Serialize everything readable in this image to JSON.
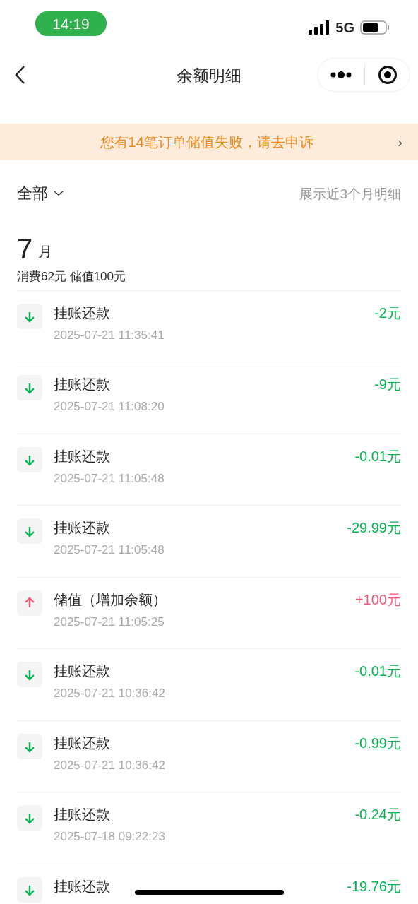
{
  "status_bar": {
    "time": "14:19",
    "network": "5G"
  },
  "nav": {
    "title": "余额明细"
  },
  "notice": {
    "text": "您有14笔订单储值失败，请去申诉",
    "arrow": "›"
  },
  "filter": {
    "label": "全部",
    "hint": "展示近3个月明细"
  },
  "month": {
    "number": "7",
    "unit": "月",
    "summary": "消费62元 储值100元"
  },
  "records": [
    {
      "kind": "out",
      "title": "挂账还款",
      "time": "2025-07-21 11:35:41",
      "amount": "-2元"
    },
    {
      "kind": "out",
      "title": "挂账还款",
      "time": "2025-07-21 11:08:20",
      "amount": "-9元"
    },
    {
      "kind": "out",
      "title": "挂账还款",
      "time": "2025-07-21 11:05:48",
      "amount": "-0.01元"
    },
    {
      "kind": "out",
      "title": "挂账还款",
      "time": "2025-07-21 11:05:48",
      "amount": "-29.99元"
    },
    {
      "kind": "in",
      "title": "储值（增加余额）",
      "time": "2025-07-21 11:05:25",
      "amount": "+100元"
    },
    {
      "kind": "out",
      "title": "挂账还款",
      "time": "2025-07-21 10:36:42",
      "amount": "-0.01元"
    },
    {
      "kind": "out",
      "title": "挂账还款",
      "time": "2025-07-21 10:36:42",
      "amount": "-0.99元"
    },
    {
      "kind": "out",
      "title": "挂账还款",
      "time": "2025-07-18 09:22:23",
      "amount": "-0.24元"
    },
    {
      "kind": "out",
      "title": "挂账还款",
      "amount": "-19.76元"
    }
  ]
}
